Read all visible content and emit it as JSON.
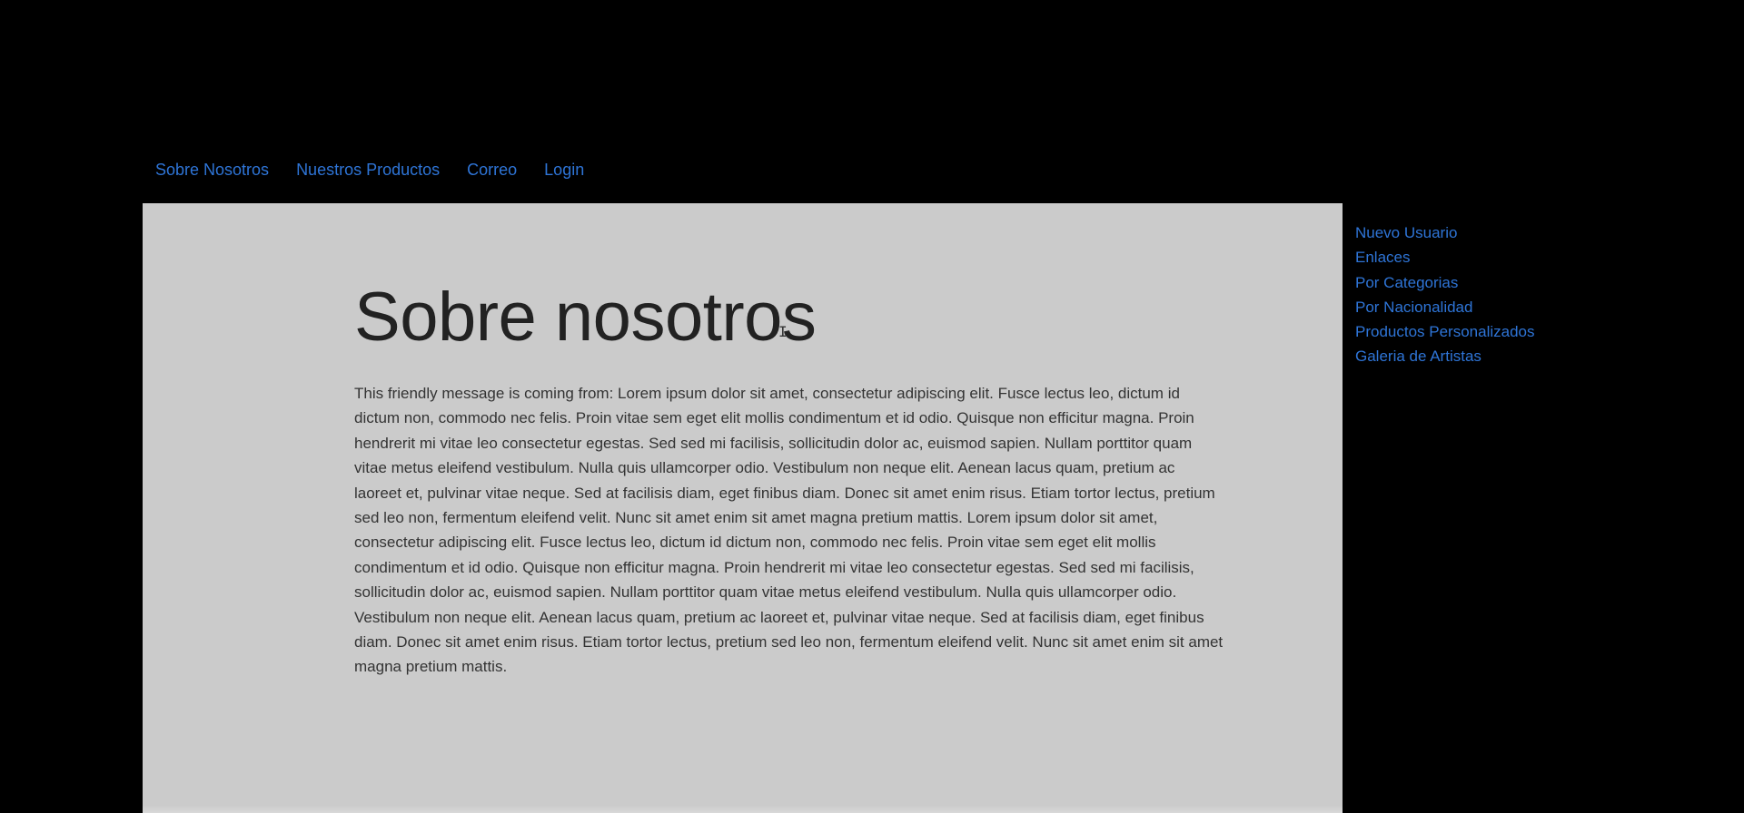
{
  "top_nav": {
    "items": [
      {
        "label": "Sobre Nosotros"
      },
      {
        "label": "Nuestros Productos"
      },
      {
        "label": "Correo"
      },
      {
        "label": "Login"
      }
    ]
  },
  "main": {
    "title": "Sobre nosotros",
    "body": "This friendly message is coming from: Lorem ipsum dolor sit amet, consectetur adipiscing elit. Fusce lectus leo, dictum id dictum non, commodo nec felis. Proin vitae sem eget elit mollis condimentum et id odio. Quisque non efficitur magna. Proin hendrerit mi vitae leo consectetur egestas. Sed sed mi facilisis, sollicitudin dolor ac, euismod sapien. Nullam porttitor quam vitae metus eleifend vestibulum. Nulla quis ullamcorper odio. Vestibulum non neque elit. Aenean lacus quam, pretium ac laoreet et, pulvinar vitae neque. Sed at facilisis diam, eget finibus diam. Donec sit amet enim risus. Etiam tortor lectus, pretium sed leo non, fermentum eleifend velit. Nunc sit amet enim sit amet magna pretium mattis. Lorem ipsum dolor sit amet, consectetur adipiscing elit. Fusce lectus leo, dictum id dictum non, commodo nec felis. Proin vitae sem eget elit mollis condimentum et id odio. Quisque non efficitur magna. Proin hendrerit mi vitae leo consectetur egestas. Sed sed mi facilisis, sollicitudin dolor ac, euismod sapien. Nullam porttitor quam vitae metus eleifend vestibulum. Nulla quis ullamcorper odio. Vestibulum non neque elit. Aenean lacus quam, pretium ac laoreet et, pulvinar vitae neque. Sed at facilisis diam, eget finibus diam. Donec sit amet enim risus. Etiam tortor lectus, pretium sed leo non, fermentum eleifend velit. Nunc sit amet enim sit amet magna pretium mattis."
  },
  "side_nav": {
    "items": [
      {
        "label": "Nuevo Usuario"
      },
      {
        "label": "Enlaces"
      },
      {
        "label": "Por Categorias"
      },
      {
        "label": "Por Nacionalidad"
      },
      {
        "label": "Productos Personalizados"
      },
      {
        "label": "Galeria de Artistas"
      }
    ]
  },
  "colors": {
    "background": "#000000",
    "panel": "#cbcbcb",
    "link": "#2e74d6",
    "title_text": "#222222",
    "body_text": "#333333"
  },
  "icons": {
    "cursor": "text-cursor-icon"
  }
}
